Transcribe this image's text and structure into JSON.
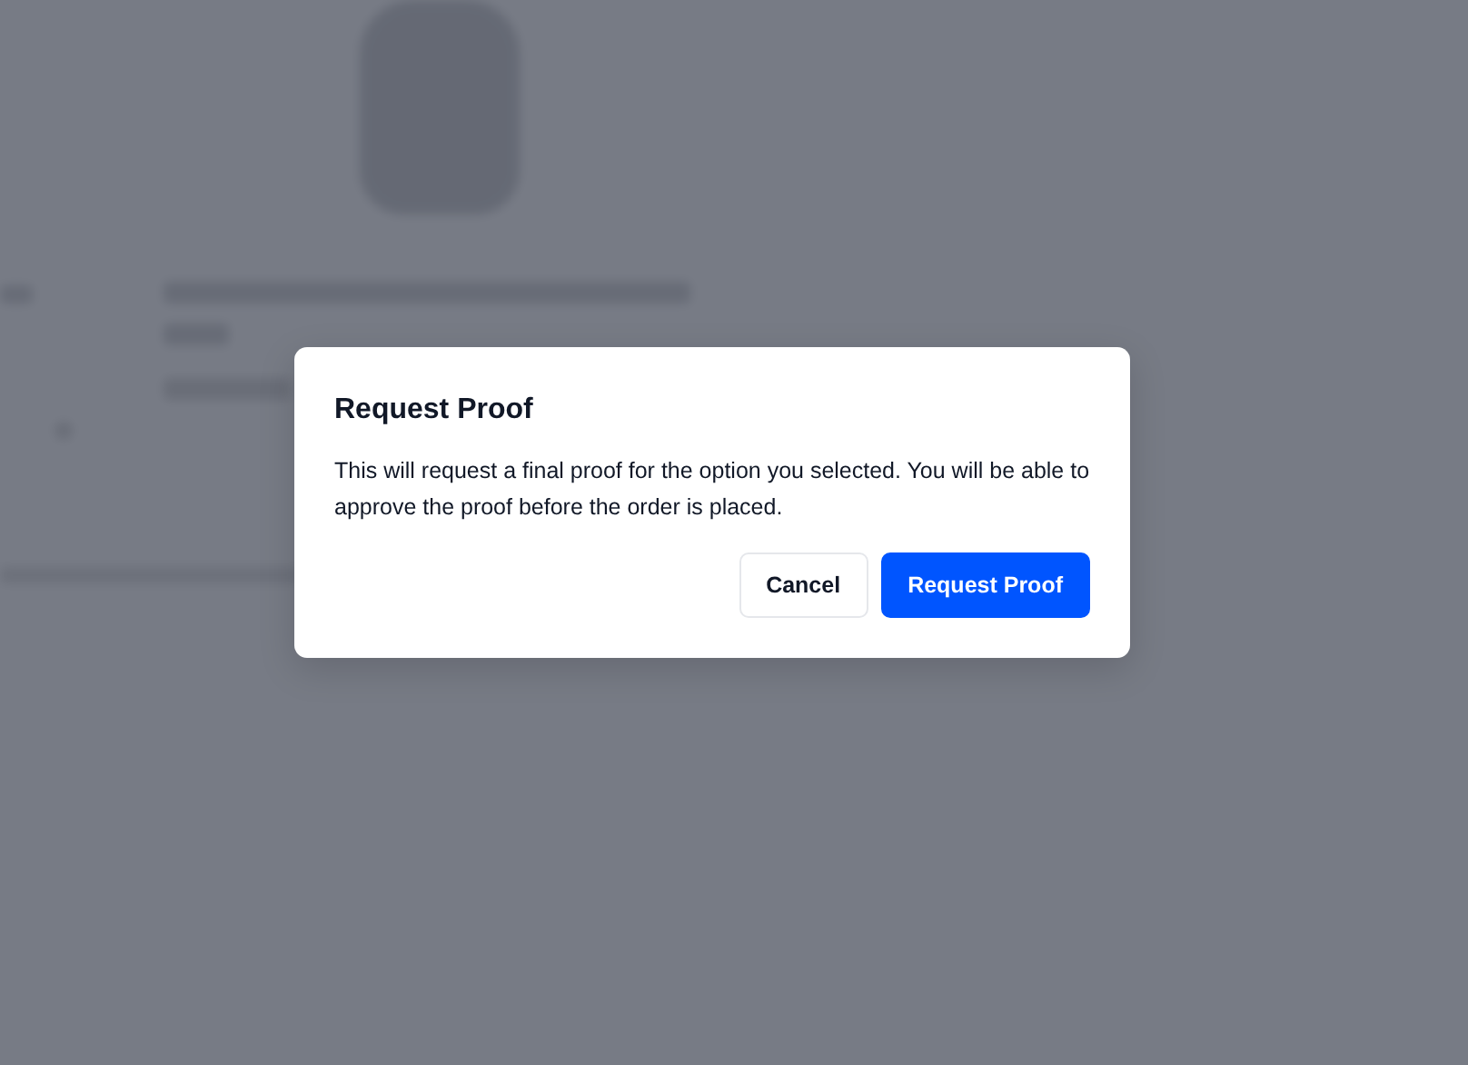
{
  "dialog": {
    "title": "Request Proof",
    "message": "This will request a final proof for the option you selected. You will be able to approve the proof before the order is placed.",
    "buttons": [
      {
        "label": "Cancel",
        "kind": "secondary"
      },
      {
        "label": "Request Proof",
        "kind": "primary"
      }
    ]
  }
}
